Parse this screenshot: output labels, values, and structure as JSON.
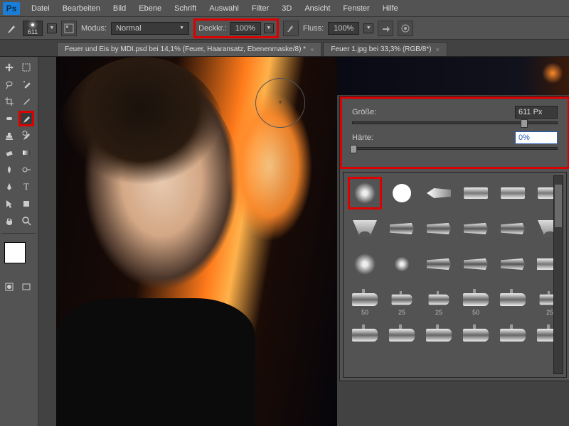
{
  "app": {
    "logo": "Ps"
  },
  "menu": [
    "Datei",
    "Bearbeiten",
    "Bild",
    "Ebene",
    "Schrift",
    "Auswahl",
    "Filter",
    "3D",
    "Ansicht",
    "Fenster",
    "Hilfe"
  ],
  "options": {
    "brush_size_label": "611",
    "mode_label": "Modus:",
    "mode_value": "Normal",
    "opacity_label": "Deckkr.:",
    "opacity_value": "100%",
    "flow_label": "Fluss:",
    "flow_value": "100%"
  },
  "tabs": [
    {
      "label": "Feuer und Eis by MDI.psd bei 14,1% (Feuer, Haaransatz, Ebenenmaske/8) *",
      "active": true
    },
    {
      "label": "Feuer 1.jpg bei 33,3% (RGB/8*)",
      "active": false
    }
  ],
  "brush_popup": {
    "size_label": "Größe:",
    "size_value": "611 Px",
    "hard_label": "Härte:",
    "hard_value": "0%",
    "tip_labels": {
      "r4c1": "50",
      "r4c2": "25",
      "r4c3": "25",
      "r4c4": "50",
      "r4c6": "25"
    }
  },
  "colors": {
    "highlight": "#d00",
    "panel": "#535353"
  }
}
